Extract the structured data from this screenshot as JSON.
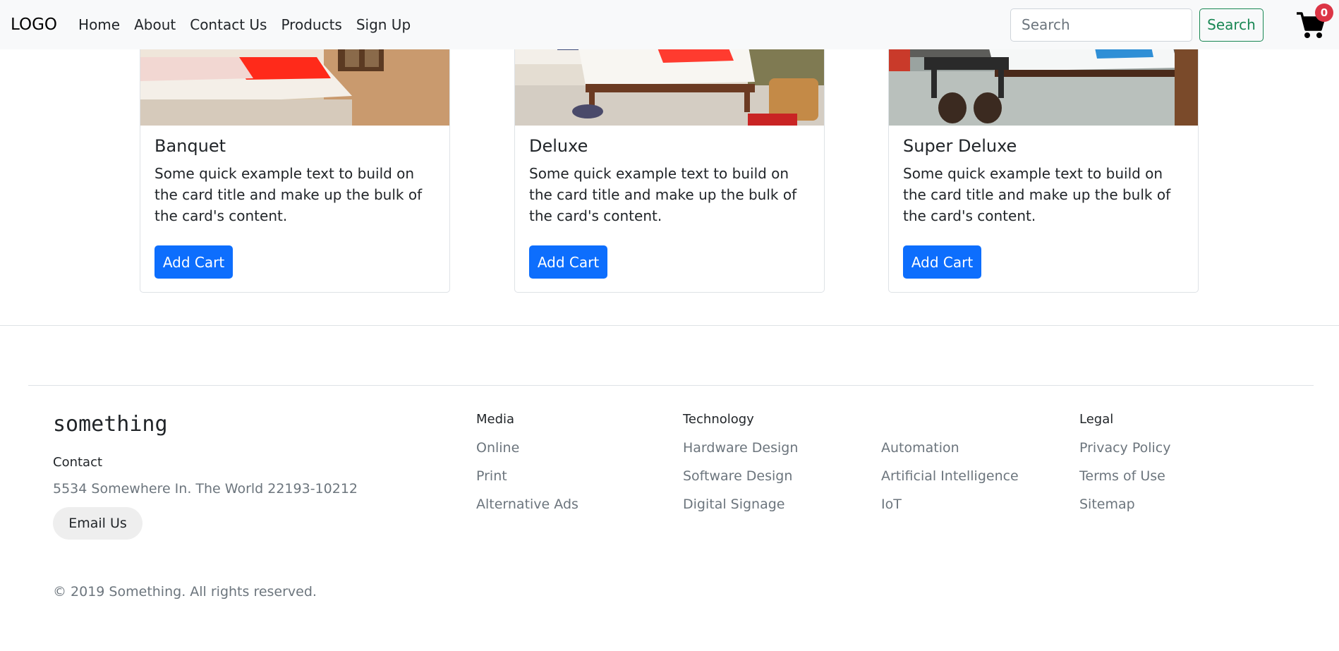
{
  "navbar": {
    "logo": "LOGO",
    "links": [
      "Home",
      "About",
      "Contact Us",
      "Products",
      "Sign Up"
    ],
    "search_placeholder": "Search",
    "search_button": "Search",
    "cart_count": "0"
  },
  "cards": [
    {
      "title": "Banquet",
      "text": "Some quick example text to build on the card title and make up the bulk of the card's content.",
      "button": "Add Cart"
    },
    {
      "title": "Deluxe",
      "text": "Some quick example text to build on the card title and make up the bulk of the card's content.",
      "button": "Add Cart"
    },
    {
      "title": "Super Deluxe",
      "text": "Some quick example text to build on the card title and make up the bulk of the card's content.",
      "button": "Add Cart"
    }
  ],
  "footer": {
    "brand": "something",
    "contact_label": "Contact",
    "address": "5534 Somewhere In. The World 22193-10212",
    "email_button": "Email Us",
    "columns": [
      {
        "heading": "Media",
        "links": [
          "Online",
          "Print",
          "Alternative Ads"
        ]
      },
      {
        "heading": "Technology",
        "links": [
          "Hardware Design",
          "Software Design",
          "Digital Signage"
        ]
      },
      {
        "heading": "",
        "links": [
          "Automation",
          "Artificial Intelligence",
          "IoT"
        ]
      },
      {
        "heading": "Legal",
        "links": [
          "Privacy Policy",
          "Terms of Use",
          "Sitemap"
        ]
      }
    ],
    "copyright": "© 2019 Something. All rights reserved."
  },
  "colors": {
    "primary": "#0d6efd",
    "success": "#198754",
    "danger": "#dc3545",
    "muted": "#6c757d"
  }
}
